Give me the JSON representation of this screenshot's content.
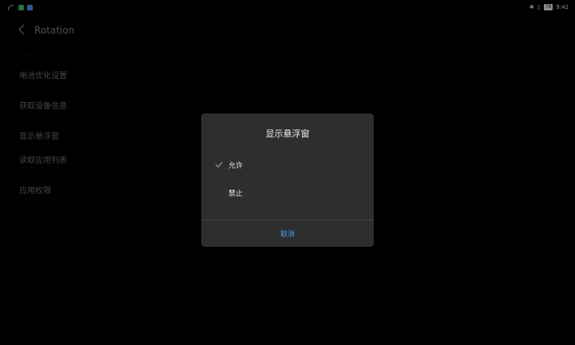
{
  "status_bar": {
    "left_icons": [
      "signal-icon",
      "app-notification-green-icon",
      "app-notification-blue-icon"
    ],
    "right_icons": [
      "bluetooth-icon",
      "vibrate-icon"
    ],
    "battery_level": "76",
    "time": "9:42"
  },
  "page": {
    "title": "Rotation",
    "section_label": "· · · · ·",
    "items": [
      {
        "title": "电池优化设置",
        "subtitle": "· · · · ·",
        "value": "· ·"
      },
      {
        "title": "获取设备信息",
        "subtitle": "· · · · ·",
        "value": "· ·"
      },
      {
        "title": "显示悬浮窗",
        "subtitle": "",
        "value": "· ·"
      },
      {
        "title": "读取应用列表",
        "subtitle": "· · · · ·",
        "value": "· ·"
      },
      {
        "title": "应用权限",
        "subtitle": "",
        "value": "· ·"
      }
    ]
  },
  "dialog": {
    "title": "显示悬浮窗",
    "options": [
      {
        "label": "允许",
        "selected": true
      },
      {
        "label": "禁止",
        "selected": false
      }
    ],
    "cancel_label": "取消",
    "accent_color": "#4a9be8"
  }
}
